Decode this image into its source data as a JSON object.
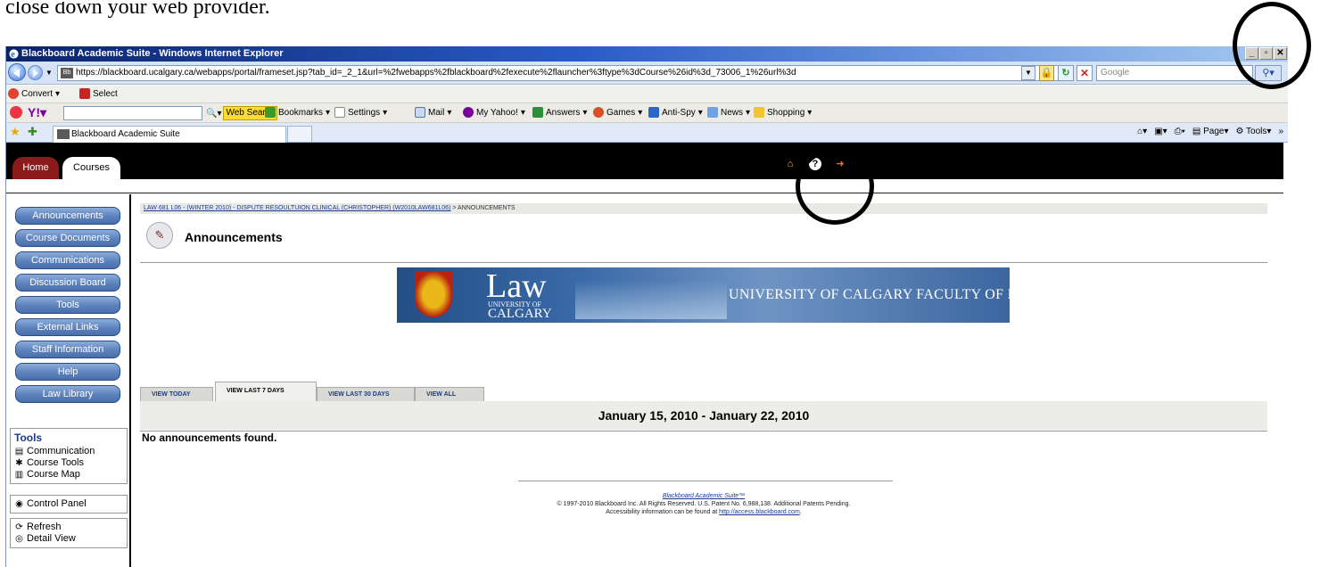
{
  "doc_text": "close down your web provider.",
  "window": {
    "title": "Blackboard Academic Suite - Windows Internet Explorer",
    "buttons": {
      "minimize": "_",
      "maximize": "▫",
      "close": "✕"
    }
  },
  "address": {
    "url": "https://blackboard.ucalgary.ca/webapps/portal/frameset.jsp?tab_id=_2_1&url=%2fwebapps%2fblackboard%2fexecute%2flauncher%3ftype%3dCourse%26id%3d_73006_1%26url%3d",
    "search_placeholder": "Google"
  },
  "convert_bar": {
    "convert": "Convert",
    "select": "Select"
  },
  "yahoo_bar": {
    "web_search": "Web Search",
    "items": [
      "Bookmarks",
      "Settings",
      "Mail",
      "My Yahoo!",
      "Answers",
      "Games",
      "Anti-Spy",
      "News",
      "Shopping"
    ]
  },
  "ie_tab": {
    "title": "Blackboard Academic Suite"
  },
  "ie_commands": {
    "page": "Page",
    "tools": "Tools"
  },
  "bb": {
    "tabs": {
      "home": "Home",
      "courses": "Courses"
    }
  },
  "course_nav": [
    "Announcements",
    "Course Documents",
    "Communications",
    "Discussion Board",
    "Tools",
    "External Links",
    "Staff Information",
    "Help",
    "Law Library"
  ],
  "tools_panel": {
    "title": "Tools",
    "items": [
      "Communication",
      "Course Tools",
      "Course Map"
    ]
  },
  "control_panel": "Control Panel",
  "view_panel": {
    "refresh": "Refresh",
    "detail": "Detail View"
  },
  "breadcrumb": {
    "course": "LAW 681 L06 - (WINTER 2010) - DISPUTE RESOULTUION CLINICAL (CHRISTOPHER) (W2010LAW681L06)",
    "current": "> ANNOUNCEMENTS"
  },
  "page_title": "Announcements",
  "banner": {
    "law": "Law",
    "university_of": "UNIVERSITY OF",
    "calgary": "CALGARY",
    "faculty": "UNIVERSITY OF CALGARY FACULTY OF LAW"
  },
  "view_tabs": [
    "VIEW TODAY",
    "VIEW LAST 7 DAYS",
    "VIEW LAST 30 DAYS",
    "VIEW ALL"
  ],
  "date_range": "January 15, 2010 - January 22, 2010",
  "no_announcements": "No announcements found.",
  "footer": {
    "brand": "Blackboard Academic Suite™",
    "copyright": "© 1997-2010 Blackboard Inc. All Rights Reserved. U.S. Patent No. 6,988,138. Additional Patents Pending.",
    "accessibility": "Accessibility information can be found at",
    "accessibility_link": "http://access.blackboard.com"
  }
}
